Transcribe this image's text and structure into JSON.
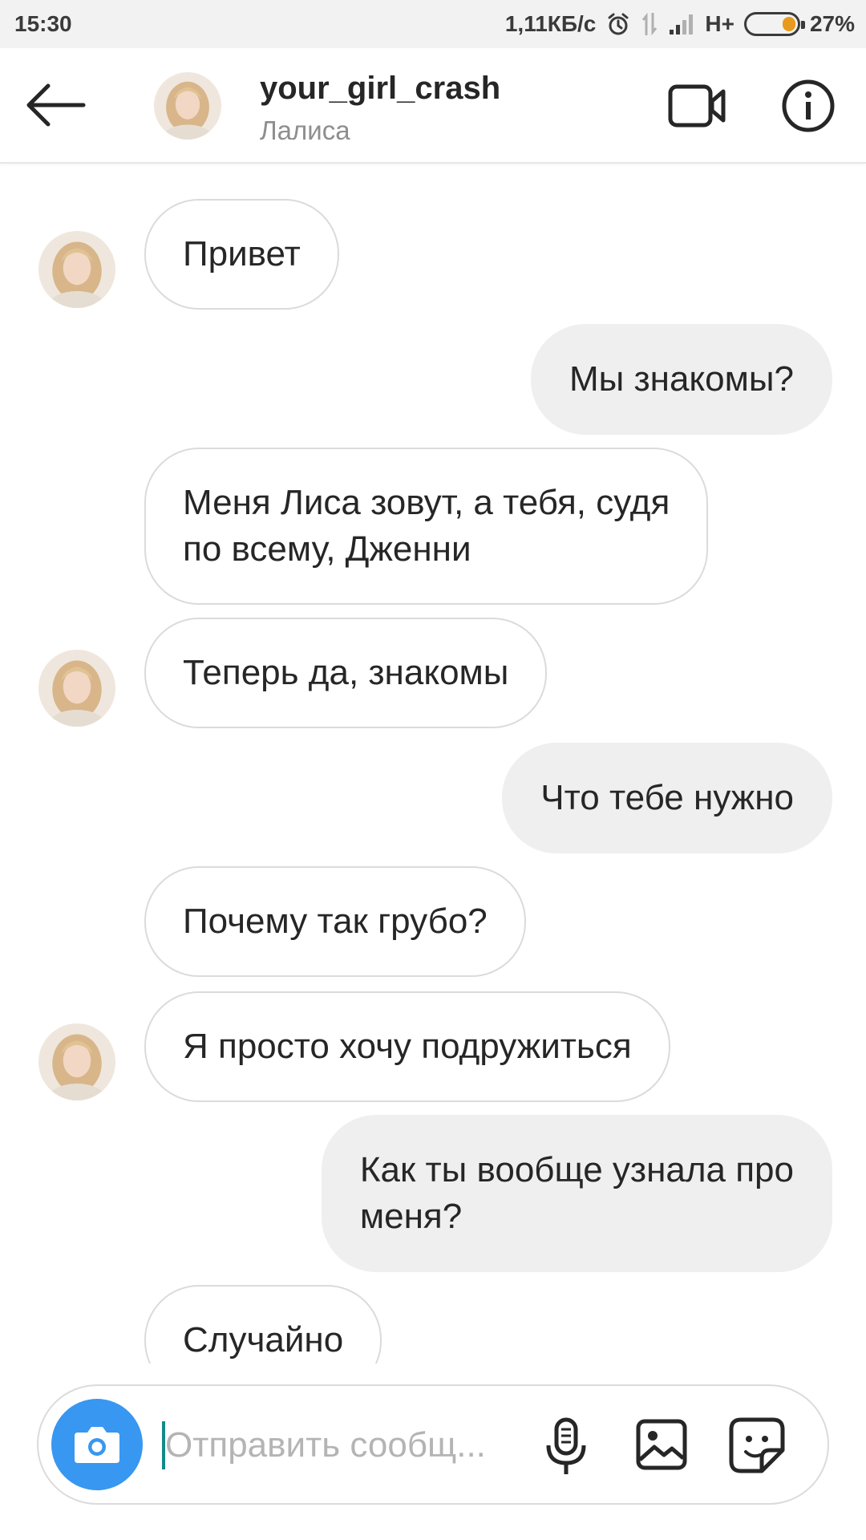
{
  "status_bar": {
    "time": "15:30",
    "speed": "1,11КБ/с",
    "network": "H+",
    "battery": "27%",
    "battery_level": 0.27,
    "icons": [
      "alarm-icon",
      "data-transfer-icon",
      "signal-icon",
      "battery-icon"
    ]
  },
  "header": {
    "username": "your_girl_crash",
    "display_name": "Лалиса",
    "icons": [
      "back-arrow-icon",
      "video-call-icon",
      "info-icon"
    ]
  },
  "messages": [
    {
      "from": "them",
      "text": "Привет",
      "avatar": true
    },
    {
      "from": "me",
      "text": "Мы знакомы?"
    },
    {
      "from": "them",
      "lines": [
        "Меня Лиса зовут, а тебя, судя",
        "по всему, Дженни"
      ]
    },
    {
      "from": "them",
      "text": "Теперь да, знакомы",
      "avatar": true
    },
    {
      "from": "me",
      "text": "Что тебе нужно"
    },
    {
      "from": "them",
      "text": "Почему так грубо?"
    },
    {
      "from": "them",
      "text": "Я просто хочу подружиться",
      "avatar": true
    },
    {
      "from": "me",
      "lines": [
        "Как ты вообще узнала про",
        "меня?"
      ]
    },
    {
      "from": "them",
      "text": "Случайно"
    }
  ],
  "composer": {
    "placeholder": "Отправить сообщ...",
    "value": "",
    "icons": [
      "camera-icon",
      "microphone-icon",
      "gallery-icon",
      "sticker-icon"
    ]
  },
  "colors": {
    "accent": "#3897f0",
    "outgoing_bubble": "#efefef",
    "incoming_border": "#dbdbdb",
    "battery_fill": "#e89a1c"
  }
}
